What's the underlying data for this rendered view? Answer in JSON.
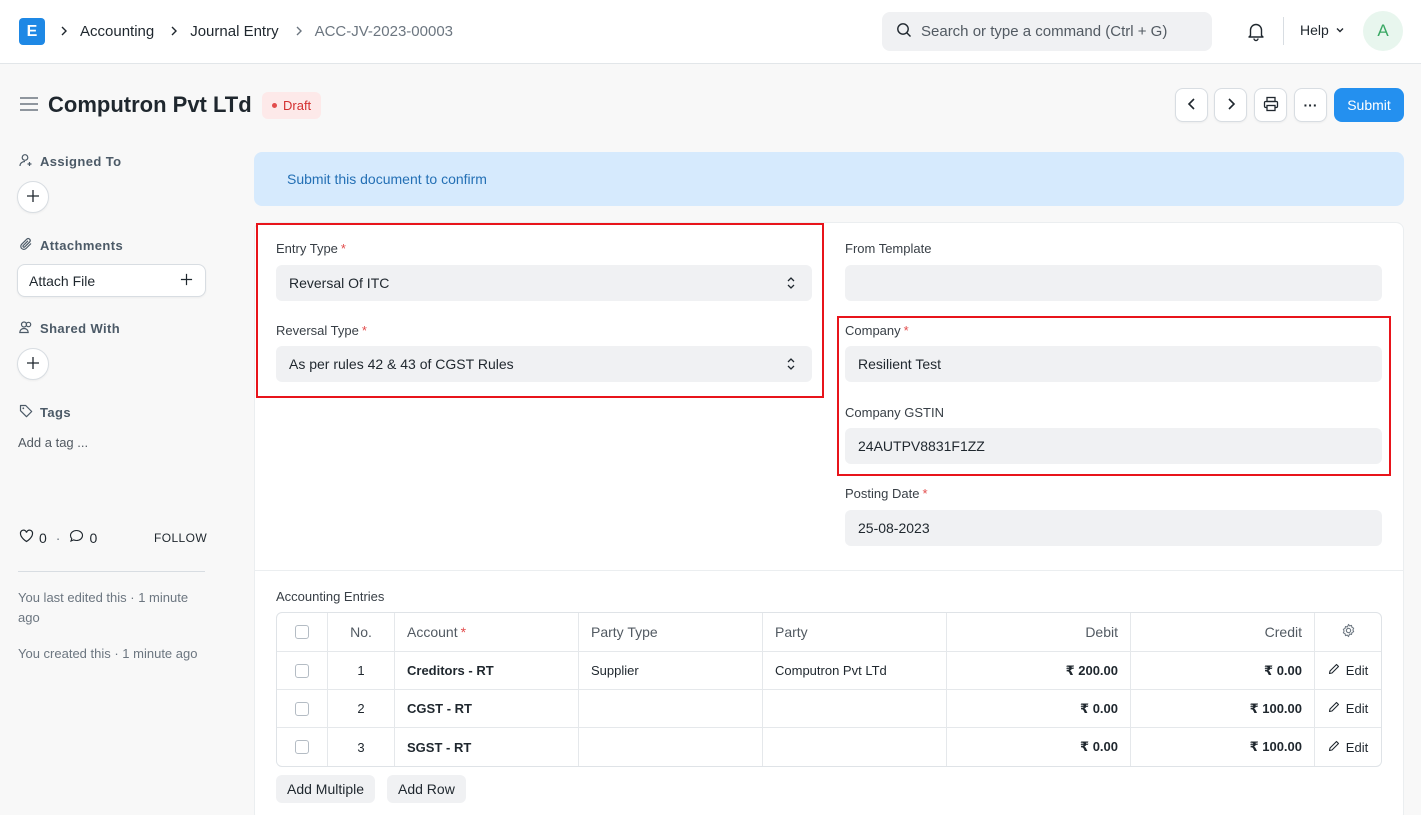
{
  "navbar": {
    "logo": "E",
    "breadcrumbs": [
      "Accounting",
      "Journal Entry",
      "ACC-JV-2023-00003"
    ],
    "search_placeholder": "Search or type a command (Ctrl + G)",
    "help_label": "Help",
    "avatar_initial": "A"
  },
  "header": {
    "title": "Computron Pvt LTd",
    "status": "Draft",
    "submit_label": "Submit",
    "more_label": "···"
  },
  "sidebar": {
    "assigned_to": "Assigned To",
    "attachments": "Attachments",
    "attach_file": "Attach File",
    "shared_with": "Shared With",
    "tags": "Tags",
    "add_tag": "Add a tag ...",
    "likes": "0",
    "comments": "0",
    "follow": "FOLLOW",
    "last_edited": "You last edited this · 1 minute ago",
    "created": "You created this · 1 minute ago"
  },
  "alert": "Submit this document to confirm",
  "form": {
    "entry_type": {
      "label": "Entry Type",
      "value": "Reversal Of ITC"
    },
    "reversal_type": {
      "label": "Reversal Type",
      "value": "As per rules 42 & 43 of CGST Rules"
    },
    "from_template": {
      "label": "From Template",
      "value": ""
    },
    "company": {
      "label": "Company",
      "value": "Resilient Test"
    },
    "company_gstin": {
      "label": "Company GSTIN",
      "value": "24AUTPV8831F1ZZ"
    },
    "posting_date": {
      "label": "Posting Date",
      "value": "25-08-2023"
    }
  },
  "table": {
    "title": "Accounting Entries",
    "columns": {
      "no": "No.",
      "account": "Account",
      "party_type": "Party Type",
      "party": "Party",
      "debit": "Debit",
      "credit": "Credit"
    },
    "rows": [
      {
        "no": "1",
        "account": "Creditors - RT",
        "party_type": "Supplier",
        "party": "Computron Pvt LTd",
        "debit": "₹ 200.00",
        "credit": "₹ 0.00",
        "edit": "Edit"
      },
      {
        "no": "2",
        "account": "CGST - RT",
        "party_type": "",
        "party": "",
        "debit": "₹ 0.00",
        "credit": "₹ 100.00",
        "edit": "Edit"
      },
      {
        "no": "3",
        "account": "SGST - RT",
        "party_type": "",
        "party": "",
        "debit": "₹ 0.00",
        "credit": "₹ 100.00",
        "edit": "Edit"
      }
    ],
    "add_multiple": "Add Multiple",
    "add_row": "Add Row"
  },
  "colors": {
    "primary": "#2490ef",
    "draft_badge": "#d32f2f",
    "highlight": "#e8141b",
    "alert_bg": "#d6eafd"
  }
}
